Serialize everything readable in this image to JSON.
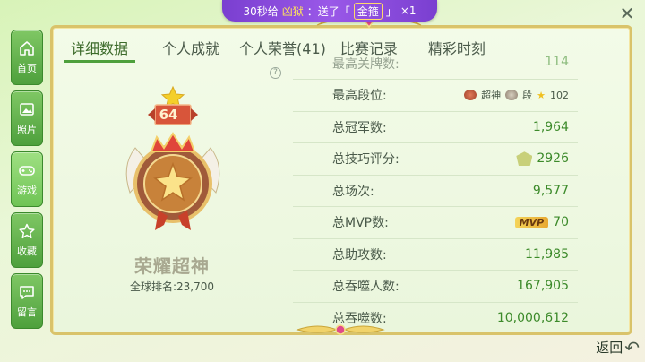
{
  "banner": {
    "prefix": "30秒给",
    "name": "凶狱",
    "sent": "：送了「",
    "gift": "金箍",
    "suffix": "」",
    "count": "×1"
  },
  "close_label": "✕",
  "sidebar": {
    "items": [
      {
        "label": "首页",
        "icon": "home-icon"
      },
      {
        "label": "照片",
        "icon": "photo-icon"
      },
      {
        "label": "游戏",
        "icon": "gamepad-icon"
      },
      {
        "label": "收藏",
        "icon": "star-icon"
      },
      {
        "label": "留言",
        "icon": "message-icon"
      }
    ],
    "active_index": 2
  },
  "tabs": [
    {
      "label": "详细数据"
    },
    {
      "label": "个人成就"
    },
    {
      "label": "个人荣誉(41)"
    },
    {
      "label": "比赛记录"
    },
    {
      "label": "精彩时刻"
    }
  ],
  "help_label": "?",
  "rank": {
    "level": "64",
    "name": "荣耀超神",
    "global_rank": "全球排名:23,700"
  },
  "stats": {
    "partial_row": {
      "label": "最高关牌数:",
      "value": "114"
    },
    "rows": [
      {
        "label": "最高段位:",
        "value_text": "超神",
        "value_sub": "段",
        "value_num": "102",
        "kind": "tier"
      },
      {
        "label": "总冠军数:",
        "value": "1,964",
        "kind": "plain"
      },
      {
        "label": "总技巧评分:",
        "value": "2926",
        "kind": "skill"
      },
      {
        "label": "总场次:",
        "value": "9,577",
        "kind": "plain"
      },
      {
        "label": "总MVP数:",
        "value": "70",
        "badge": "MVP",
        "kind": "mvp"
      },
      {
        "label": "总助攻数:",
        "value": "11,985",
        "kind": "plain"
      },
      {
        "label": "总吞噬人数:",
        "value": "167,905",
        "kind": "plain"
      },
      {
        "label": "总吞噬数:",
        "value": "10,000,612",
        "kind": "plain"
      }
    ]
  },
  "back_label": "返回",
  "colors": {
    "accent_green": "#4ea03c",
    "value_green": "#3c8a2a",
    "frame_gold": "#d9c36a",
    "banner_purple": "#8a4ee0"
  }
}
